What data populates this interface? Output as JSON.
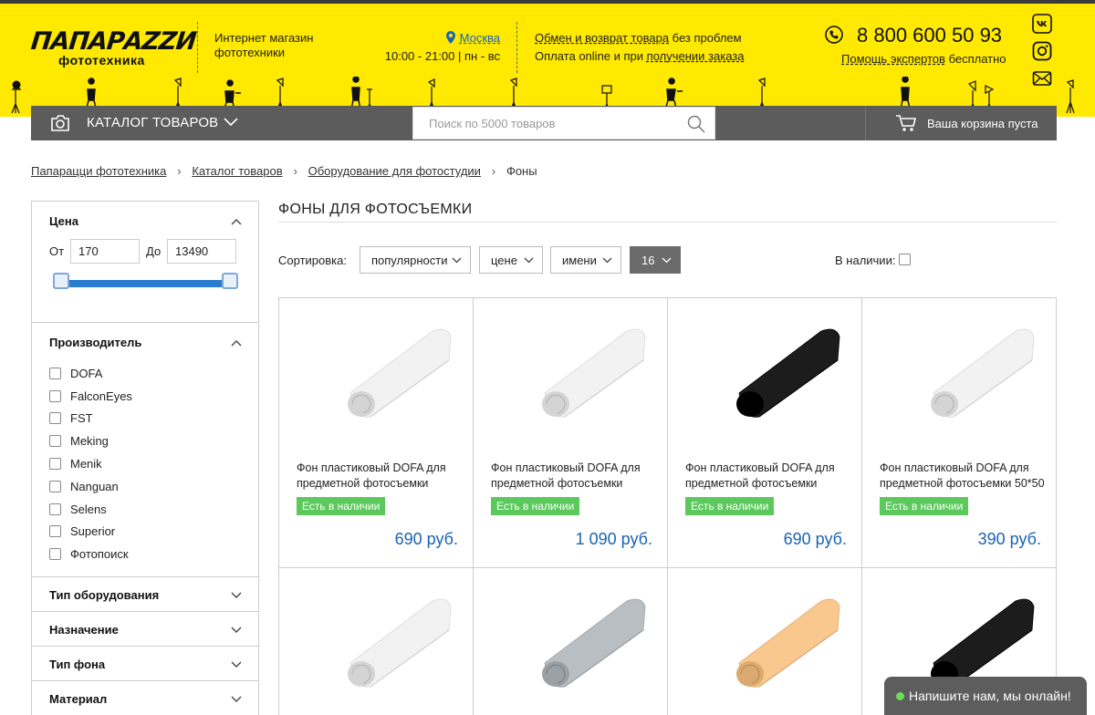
{
  "header": {
    "logo_main": "ПАПАРАZZИ",
    "logo_sub": "фототехника",
    "shop_desc_line1": "Интернет магазин",
    "shop_desc_line2": "фототехники",
    "city": "Москва",
    "hours": "10:00 - 21:00 | пн - вс",
    "info_line1_link": "Обмен и возврат товара",
    "info_line1_rest": " без проблем",
    "info_line2_pre": "Оплата online и при ",
    "info_line2_link": "получении заказа",
    "phone": "8 800 600 50 93",
    "expert_link": "Помощь экспертов",
    "expert_rest": " бесплатно",
    "social": [
      "vk-icon",
      "instagram-icon",
      "mail-icon"
    ]
  },
  "navbar": {
    "catalog_label": "КАТАЛОГ ТОВАРОВ",
    "search_placeholder": "Поиск по 5000 товаров",
    "cart_label": "Ваша корзина пуста"
  },
  "breadcrumb": [
    "Папарацци фототехника",
    "Каталог товаров",
    "Оборудование для фотостудии",
    "Фоны"
  ],
  "filters": {
    "price": {
      "title": "Цена",
      "from_label": "От",
      "to_label": "До",
      "min": "170",
      "max": "13490"
    },
    "manufacturer": {
      "title": "Производитель",
      "items": [
        "DOFA",
        "FalconEyes",
        "FST",
        "Meking",
        "Menik",
        "Nanguan",
        "Selens",
        "Superior",
        "Фотопоиск"
      ]
    },
    "collapsed": [
      "Тип оборудования",
      "Назначение",
      "Тип фона",
      "Материал"
    ]
  },
  "main": {
    "title": "ФОНЫ ДЛЯ ФОТОСЪЕМКИ",
    "sort_label": "Сортировка:",
    "sort_options": [
      "популярности",
      "цене",
      "имени"
    ],
    "per_page": "16",
    "in_stock_label": "В наличии:"
  },
  "products": [
    {
      "name": "Фон пластиковый DOFA для предметной фотосъемки",
      "badge": "Есть в наличии",
      "price": "690 руб.",
      "color": "#f2f2f2"
    },
    {
      "name": "Фон пластиковый DOFA для предметной фотосъемки",
      "badge": "Есть в наличии",
      "price": "1 090 руб.",
      "color": "#f2f2f2"
    },
    {
      "name": "Фон пластиковый DOFA для предметной фотосъемки",
      "badge": "Есть в наличии",
      "price": "690 руб.",
      "color": "#1c1c1c"
    },
    {
      "name": "Фон пластиковый DOFA для предметной фотосъемки 50*50",
      "badge": "Есть в наличии",
      "price": "390 руб.",
      "color": "#f2f2f2"
    },
    {
      "name": "",
      "badge": "",
      "price": "",
      "color": "#f2f2f2"
    },
    {
      "name": "",
      "badge": "",
      "price": "",
      "color": "#b9bec2"
    },
    {
      "name": "",
      "badge": "",
      "price": "",
      "color": "#f8c88e"
    },
    {
      "name": "",
      "badge": "",
      "price": "",
      "color": "#1c1c1c"
    }
  ],
  "chat": {
    "label": "Напишите нам, мы онлайн!"
  },
  "colors": {
    "brand_yellow": "#ffe900",
    "nav_gray": "#5c5c5c",
    "link_blue": "#1a63b5",
    "stock_green": "#5cc95c"
  }
}
